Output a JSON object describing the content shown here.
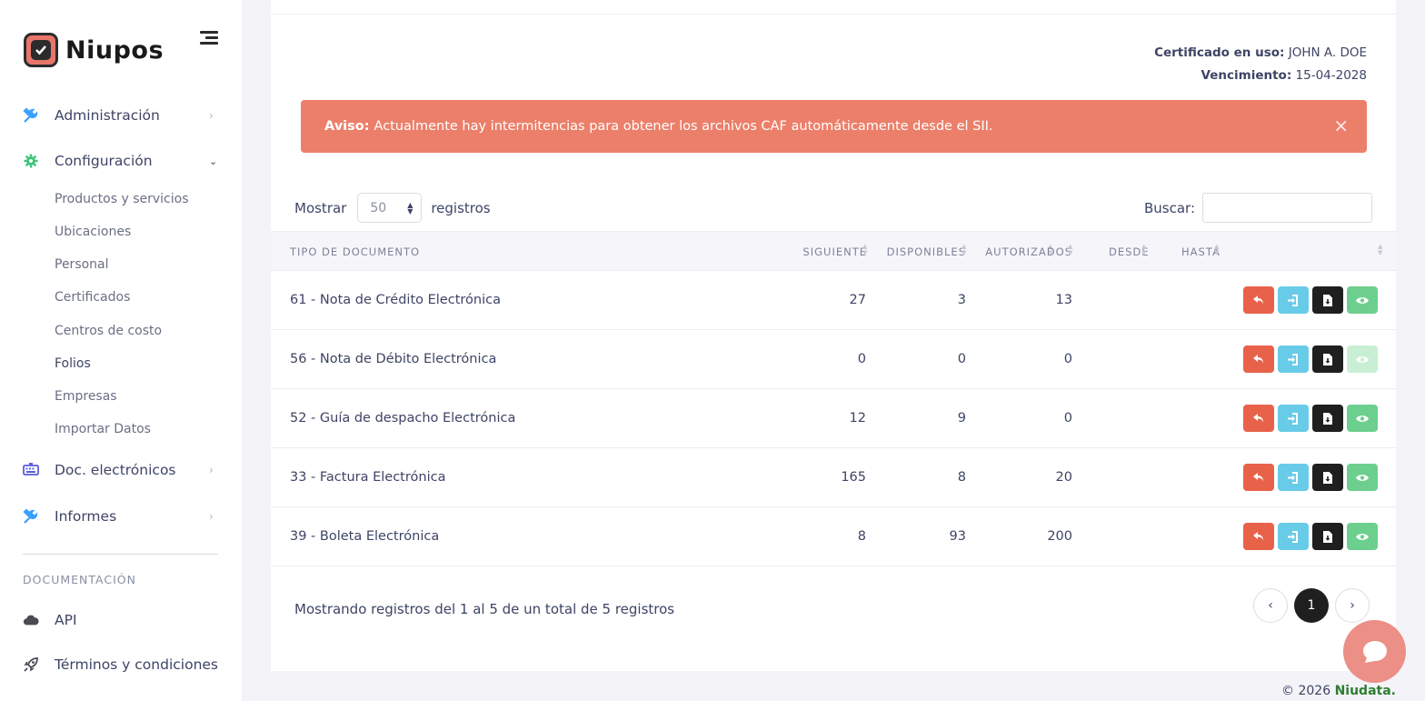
{
  "app": {
    "name": "Niupos"
  },
  "sidebar": {
    "items": [
      {
        "label": "Administración",
        "icon": "tools-icon",
        "color": "#3aa0ff"
      },
      {
        "label": "Configuración",
        "icon": "gear-icon",
        "color": "#3cc27a"
      },
      {
        "label": "Doc. electrónicos",
        "icon": "keyboard-icon",
        "color": "#5b5fdc"
      },
      {
        "label": "Informes",
        "icon": "tools-icon",
        "color": "#3aa0ff"
      }
    ],
    "subitems": [
      "Productos y servicios",
      "Ubicaciones",
      "Personal",
      "Certificados",
      "Centros de costo",
      "Folios",
      "Empresas",
      "Importar Datos"
    ],
    "active_subitem": "Folios",
    "section_title": "DOCUMENTACIÓN",
    "doc_items": [
      {
        "label": "API",
        "icon": "cloud-icon"
      },
      {
        "label": "Términos y condiciones",
        "icon": "rocket-icon"
      }
    ]
  },
  "cert": {
    "label": "Certificado en uso:",
    "value": "JOHN A. DOE",
    "expiry_label": "Vencimiento:",
    "expiry_value": "15-04-2028"
  },
  "alert": {
    "title": "Aviso:",
    "message": "Actualmente hay intermitencias para obtener los archivos CAF automáticamente desde el SII.",
    "close": "×"
  },
  "table_controls": {
    "show_label": "Mostrar",
    "show_value": "50",
    "records_label": "registros",
    "search_label": "Buscar:"
  },
  "table": {
    "headers": [
      "TIPO DE DOCUMENTO",
      "SIGUIENTE",
      "DISPONIBLES",
      "AUTORIZADOS",
      "DESDE",
      "HASTA"
    ],
    "rows": [
      {
        "tipo": "61 - Nota de Crédito Electrónica",
        "siguiente": "27",
        "disponibles": "3",
        "autorizados": "13",
        "desde": "",
        "hasta": "",
        "view_enabled": true
      },
      {
        "tipo": "56 - Nota de Débito Electrónica",
        "siguiente": "0",
        "disponibles": "0",
        "autorizados": "0",
        "desde": "",
        "hasta": "",
        "view_enabled": false
      },
      {
        "tipo": "52 - Guía de despacho Electrónica",
        "siguiente": "12",
        "disponibles": "9",
        "autorizados": "0",
        "desde": "",
        "hasta": "",
        "view_enabled": true
      },
      {
        "tipo": "33 - Factura Electrónica",
        "siguiente": "165",
        "disponibles": "8",
        "autorizados": "20",
        "desde": "",
        "hasta": "",
        "view_enabled": true
      },
      {
        "tipo": "39 - Boleta Electrónica",
        "siguiente": "8",
        "disponibles": "93",
        "autorizados": "200",
        "desde": "",
        "hasta": "",
        "view_enabled": true
      }
    ]
  },
  "pagination": {
    "info": "Mostrando registros del 1 al 5 de un total de 5 registros",
    "current": "1"
  },
  "footer": {
    "copyright": "© 2026",
    "company": "Niudata."
  },
  "colors": {
    "alert_bg": "#ec7f6a",
    "btn_return": "#e8624a",
    "btn_import": "#68cbe8",
    "btn_download": "#1f1f1f",
    "btn_view": "#6ccf8e"
  }
}
